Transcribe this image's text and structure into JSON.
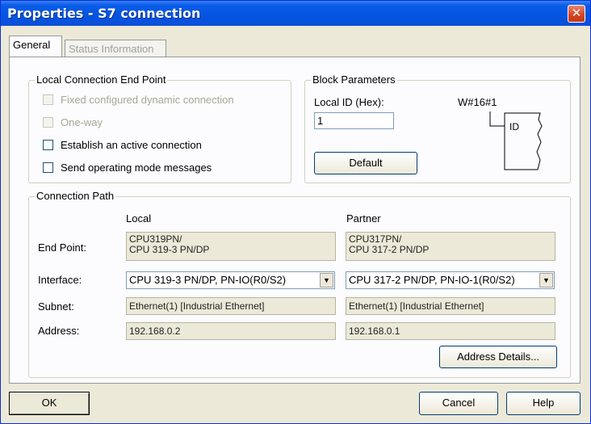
{
  "window": {
    "title": "Properties - S7 connection",
    "close_glyph": "✕"
  },
  "tabs": [
    {
      "label": "General",
      "active": true
    },
    {
      "label": "Status Information",
      "active": false
    }
  ],
  "local_endpoint": {
    "group_label": "Local Connection End Point",
    "options": [
      {
        "label": "Fixed configured dynamic connection",
        "checked": false,
        "enabled": false
      },
      {
        "label": "One-way",
        "checked": false,
        "enabled": false
      },
      {
        "label": "Establish an active connection",
        "checked": false,
        "enabled": true
      },
      {
        "label": "Send operating mode messages",
        "checked": false,
        "enabled": true
      }
    ]
  },
  "block_params": {
    "group_label": "Block Parameters",
    "local_id_label": "Local ID (Hex):",
    "local_id_value": "1",
    "word_label": "W#16#1",
    "id_label": "ID",
    "default_button": "Default"
  },
  "connection_path": {
    "group_label": "Connection Path",
    "col_local": "Local",
    "col_partner": "Partner",
    "row_endpoint": "End Point:",
    "row_interface": "Interface:",
    "row_subnet": "Subnet:",
    "row_address": "Address:",
    "local": {
      "endpoint_line1": "CPU319PN/",
      "endpoint_line2": "CPU 319-3 PN/DP",
      "interface": "CPU 319-3 PN/DP, PN-IO(R0/S2)",
      "subnet": "Ethernet(1) [Industrial Ethernet]",
      "address": "192.168.0.2"
    },
    "partner": {
      "endpoint_line1": "CPU317PN/",
      "endpoint_line2": "CPU 317-2 PN/DP",
      "interface": "CPU 317-2 PN/DP, PN-IO-1(R0/S2)",
      "subnet": "Ethernet(1) [Industrial Ethernet]",
      "address": "192.168.0.1"
    },
    "address_details_button": "Address Details..."
  },
  "footer": {
    "ok": "OK",
    "cancel": "Cancel",
    "help": "Help"
  }
}
